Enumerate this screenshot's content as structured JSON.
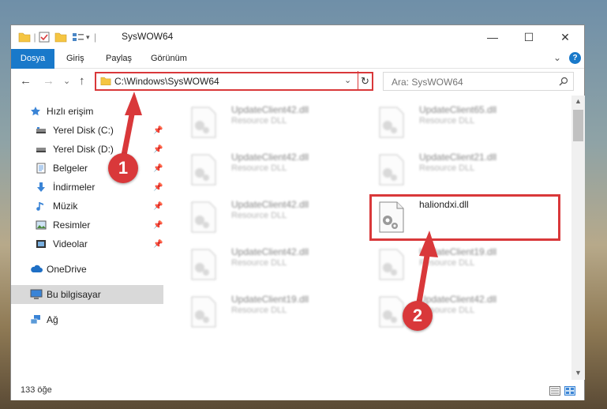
{
  "window": {
    "title": "SysWOW64",
    "minimize": "—",
    "maximize": "☐",
    "close": "✕"
  },
  "ribbon": {
    "tabs": [
      "Dosya",
      "Giriş",
      "Paylaş",
      "Görünüm"
    ],
    "expand": "⌄",
    "help": "?"
  },
  "nav": {
    "back": "←",
    "forward": "→",
    "recent": "⌄",
    "up": "↑",
    "address": "C:\\Windows\\SysWOW64",
    "refresh": "↻",
    "search_placeholder": "Ara: SysWOW64"
  },
  "sidebar": {
    "items": [
      {
        "label": "Hızlı erişim",
        "icon": "star-icon"
      },
      {
        "label": "Yerel Disk (C:)",
        "icon": "drive-icon",
        "pinned": true
      },
      {
        "label": "Yerel Disk (D:)",
        "icon": "drive-icon",
        "pinned": true
      },
      {
        "label": "Belgeler",
        "icon": "documents-icon",
        "pinned": true
      },
      {
        "label": "İndirmeler",
        "icon": "download-icon",
        "pinned": true
      },
      {
        "label": "Müzik",
        "icon": "music-icon",
        "pinned": true
      },
      {
        "label": "Resimler",
        "icon": "pictures-icon",
        "pinned": true
      },
      {
        "label": "Videolar",
        "icon": "videos-icon",
        "pinned": true
      },
      {
        "label": "OneDrive",
        "icon": "cloud-icon"
      },
      {
        "label": "Bu bilgisayar",
        "icon": "computer-icon"
      },
      {
        "label": "Ağ",
        "icon": "network-icon"
      }
    ]
  },
  "files": [
    {
      "name": "UpdateClient42.dll",
      "type": "Resource DLL"
    },
    {
      "name": "UpdateClient65.dll",
      "type": "Resource DLL"
    },
    {
      "name": "UpdateClient42.dll",
      "type": "Resource DLL"
    },
    {
      "name": "UpdateClient21.dll",
      "type": "Resource DLL"
    },
    {
      "name": "UpdateClient42.dll",
      "type": "Resource DLL"
    },
    {
      "name": "haliondxi.dll",
      "type": ""
    },
    {
      "name": "UpdateClient42.dll",
      "type": "Resource DLL"
    },
    {
      "name": "UpdateClient19.dll",
      "type": "Resource DLL"
    },
    {
      "name": "UpdateClient19.dll",
      "type": "Resource DLL"
    },
    {
      "name": "UpdateClient42.dll",
      "type": "Resource DLL"
    }
  ],
  "status": {
    "count": "133 öğe"
  },
  "markers": {
    "one": "1",
    "two": "2"
  },
  "colors": {
    "accent": "#1979ca",
    "highlight": "#d9383a",
    "folder": "#f5c542"
  }
}
